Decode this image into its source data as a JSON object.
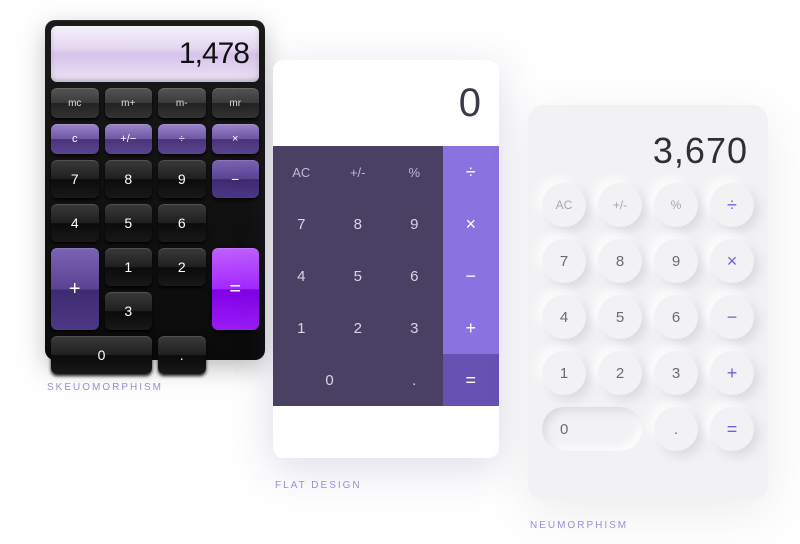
{
  "labels": {
    "skeu": "SKEUOMORPHISM",
    "flat": "FLAT DESIGN",
    "neu": "NEUMORPHISM"
  },
  "skeu": {
    "display": "1,478",
    "row1": [
      "mc",
      "m+",
      "m-",
      "mr"
    ],
    "row2": [
      "c",
      "+/−",
      "÷",
      "×"
    ],
    "n7": "7",
    "n8": "8",
    "n9": "9",
    "minus": "−",
    "n4": "4",
    "n5": "5",
    "n6": "6",
    "plus": "+",
    "n1": "1",
    "n2": "2",
    "n3": "3",
    "n0": "0",
    "dot": ".",
    "eq": "="
  },
  "flat": {
    "display": "0",
    "ac": "AC",
    "pm": "+/-",
    "pct": "%",
    "div": "÷",
    "n7": "7",
    "n8": "8",
    "n9": "9",
    "mul": "×",
    "n4": "4",
    "n5": "5",
    "n6": "6",
    "minus": "−",
    "n1": "1",
    "n2": "2",
    "n3": "3",
    "plus": "+",
    "n0": "0",
    "dot": ".",
    "eq": "="
  },
  "neu": {
    "display": "3,670",
    "ac": "AC",
    "pm": "+/-",
    "pct": "%",
    "div": "÷",
    "n7": "7",
    "n8": "8",
    "n9": "9",
    "mul": "×",
    "n4": "4",
    "n5": "5",
    "n6": "6",
    "minus": "−",
    "n1": "1",
    "n2": "2",
    "n3": "3",
    "plus": "+",
    "n0": "0",
    "dot": ".",
    "eq": "="
  }
}
